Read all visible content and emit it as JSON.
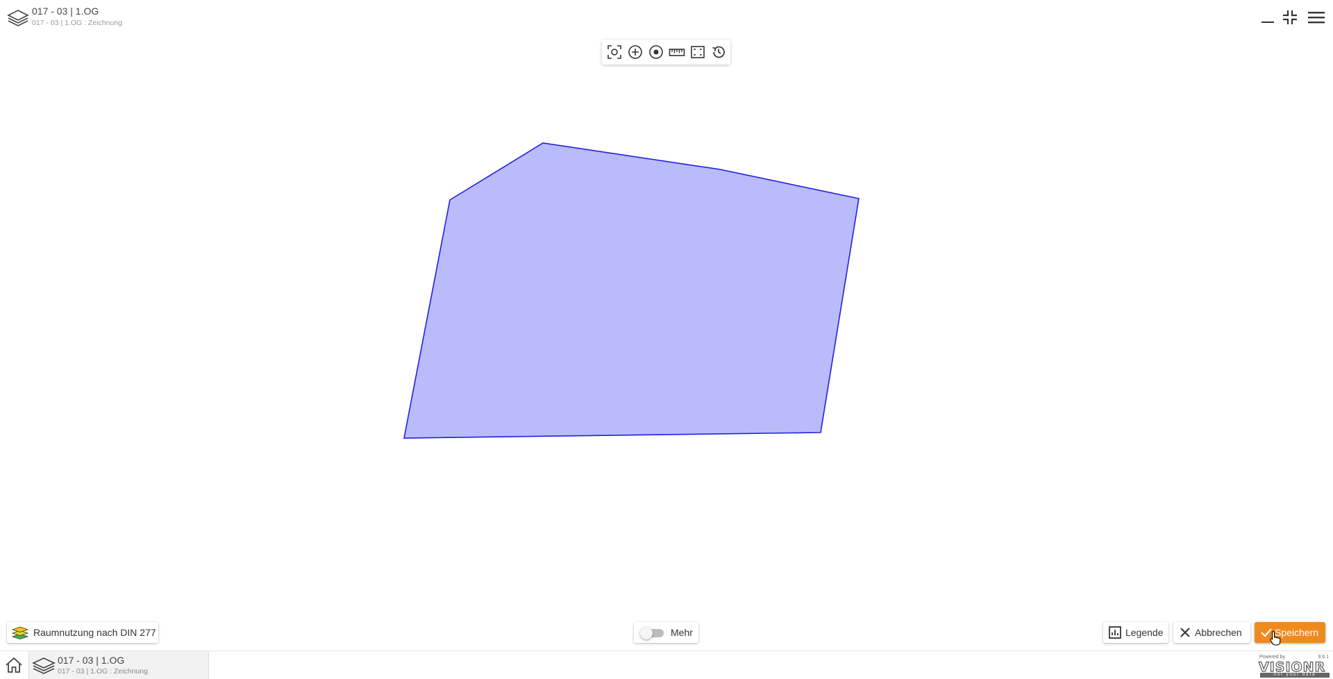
{
  "header": {
    "title": "017 - 03 | 1.OG",
    "subtitle": "017 - 03 | 1.OG : Zeichnung",
    "icons": [
      "layers-icon",
      "minimize-icon",
      "exit-fullscreen-icon",
      "menu-icon"
    ]
  },
  "toolbar": {
    "tools": [
      "screenshot-icon",
      "zoom-in-icon",
      "center-icon",
      "ruler-icon",
      "fit-extent-icon",
      "history-icon"
    ]
  },
  "map": {
    "polygon_fill": "#babbfb",
    "polygon_stroke": "#1f1fe0"
  },
  "bottom": {
    "layer_label": "Raumnutzung nach DIN 277",
    "mehr_label": "Mehr",
    "mehr_toggle_on": false,
    "legend_label": "Legende",
    "cancel_label": "Abbrechen",
    "save_label": "Speichern"
  },
  "footer": {
    "tab_title": "017 - 03 | 1.OG",
    "tab_subtitle": "017 - 03 | 1.OG : Zeichnung",
    "powered_by": "Powered by",
    "version": "9.6.1",
    "brand": "VISIONR",
    "brand_tagline": "not your data"
  },
  "colors": {
    "accent": "#ef8a1f",
    "text": "#333333"
  }
}
